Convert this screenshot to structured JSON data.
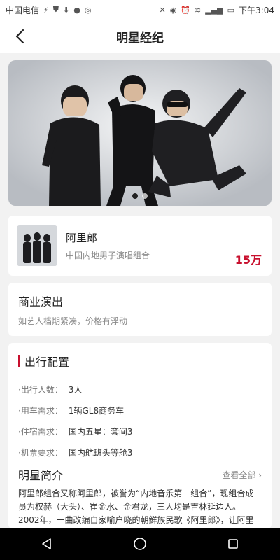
{
  "status_bar": {
    "carrier": "中国电信",
    "time": "下午3:04",
    "left_icons": [
      "usb-icon",
      "shield-icon",
      "download-icon",
      "message-icon",
      "app-icon"
    ],
    "right_icons": [
      "mute-icon",
      "eye-icon",
      "alarm-icon",
      "wifi-icon",
      "signal-icon",
      "battery-icon"
    ]
  },
  "header": {
    "title": "明星经纪",
    "back_icon": "back-arrow-icon"
  },
  "banner": {
    "dots": 2,
    "active_dot": 0
  },
  "artist": {
    "name": "阿里郎",
    "description": "中国内地男子演唱组合",
    "price": "15万"
  },
  "performance": {
    "title": "商业演出",
    "subtitle": "如艺人档期紧凑，价格有浮动"
  },
  "config": {
    "title": "出行配置",
    "rows": [
      {
        "label": "·出行人数：",
        "value": "3人"
      },
      {
        "label": "·用车需求：",
        "value": "1辆GL8商务车"
      },
      {
        "label": "·住宿需求：",
        "value": "国内五星：套间3"
      },
      {
        "label": "·机票要求：",
        "value": "国内航班头等舱3"
      }
    ]
  },
  "intro": {
    "title": "明星简介",
    "view_all": "查看全部",
    "text": "阿里郎组合又称阿里郎，被誉为“内地音乐第一组合”，现组合成员为权赫（大头）、崔金水、金君龙，三人均是吉林延边人。2002年，一曲改编自家喻户晓的朝鲜族民歌《阿里郎》，让阿里郎组合在内地歌坛异军突起，一炮走红，发展势头强劲。阿里…"
  },
  "system_nav": {
    "icons": [
      "back-triangle-icon",
      "home-circle-icon",
      "recents-square-icon"
    ]
  },
  "colors": {
    "accent": "#c8102e",
    "background": "#f2f2f2"
  }
}
